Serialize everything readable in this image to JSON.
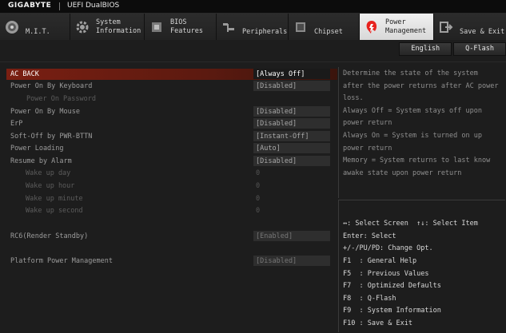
{
  "brand": {
    "logo": "GIGABYTE",
    "product": "UEFI DualBIOS"
  },
  "tabs": [
    {
      "id": "mit",
      "label": "M.I.T.",
      "icon": "disc-icon",
      "active": false
    },
    {
      "id": "system-information",
      "label": "System\nInformation",
      "icon": "gear-icon",
      "active": false
    },
    {
      "id": "bios-features",
      "label": "BIOS\nFeatures",
      "icon": "bios-chip-icon",
      "active": false
    },
    {
      "id": "peripherals",
      "label": "Peripherals",
      "icon": "usb-icon",
      "active": false
    },
    {
      "id": "chipset",
      "label": "Chipset",
      "icon": "chip-icon",
      "active": false
    },
    {
      "id": "power-management",
      "label": "Power\nManagement",
      "icon": "power-icon",
      "active": true
    },
    {
      "id": "save-exit",
      "label": "Save & Exit",
      "icon": "exit-icon",
      "active": false
    }
  ],
  "utility": {
    "language": "English",
    "qflash": "Q-Flash"
  },
  "settings": [
    {
      "label": "AC BACK",
      "value": "[Always Off]",
      "state": "selected"
    },
    {
      "label": "Power On By Keyboard",
      "value": "[Disabled]",
      "state": "normal"
    },
    {
      "label": "Power On Password",
      "value": "",
      "state": "disabled"
    },
    {
      "label": "Power On By Mouse",
      "value": "[Disabled]",
      "state": "normal"
    },
    {
      "label": "ErP",
      "value": "[Disabled]",
      "state": "normal"
    },
    {
      "label": "Soft-Off by PWR-BTTN",
      "value": "[Instant-Off]",
      "state": "normal"
    },
    {
      "label": "Power Loading",
      "value": "[Auto]",
      "state": "normal"
    },
    {
      "label": "Resume by Alarm",
      "value": "[Disabled]",
      "state": "normal"
    },
    {
      "label": "Wake up day",
      "value": "0",
      "state": "disabled"
    },
    {
      "label": "Wake up hour",
      "value": "0",
      "state": "disabled"
    },
    {
      "label": "Wake up minute",
      "value": "0",
      "state": "disabled"
    },
    {
      "label": "Wake up second",
      "value": "0",
      "state": "disabled"
    },
    {
      "label": "RC6(Render Standby)",
      "value": "[Enabled]",
      "state": "greyed"
    },
    {
      "label": "Platform Power Management",
      "value": "[Disabled]",
      "state": "greyed"
    }
  ],
  "help": [
    "Determine the state of  the system",
    "after the power returns after AC power",
    "loss.",
    "Always Off = System stays off upon",
    "power return",
    "Always On = System is turned on up",
    "power return",
    "Memory = System returns to last know",
    "awake state upon power return"
  ],
  "keys": [
    "↔: Select Screen  ↑↓: Select Item",
    "Enter: Select",
    "+/-/PU/PD: Change Opt.",
    "F1  : General Help",
    "F5  : Previous Values",
    "F7  : Optimized Defaults",
    "F8  : Q-Flash",
    "F9  : System Information",
    "F10 : Save & Exit"
  ],
  "colors": {
    "accent": "#e8231f",
    "selected_row": "#7a1f12",
    "background": "#1d1d1d"
  }
}
